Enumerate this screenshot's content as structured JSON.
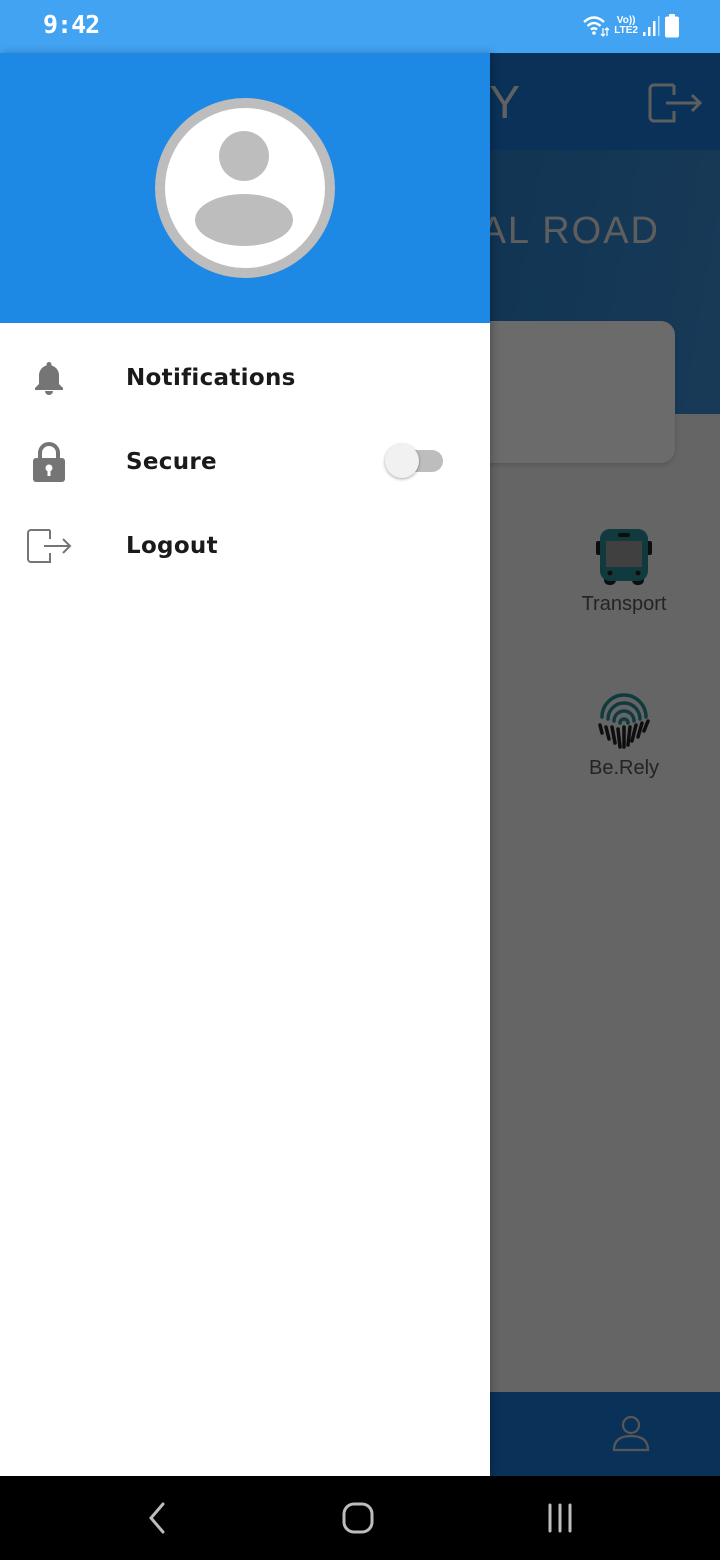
{
  "status_bar": {
    "time": "9:42",
    "network_label_top": "Vo))",
    "network_label_bottom": "LTE2",
    "icons": [
      "wifi-icon",
      "signal-icon",
      "battery-icon"
    ]
  },
  "background_app": {
    "title_fragment": "Y",
    "banner_text_fragment": "AL ROAD",
    "tiles": [
      {
        "label": "Transport",
        "icon": "bus-icon"
      },
      {
        "label": "Be.Rely",
        "icon": "fingerprint-icon"
      }
    ],
    "colors": {
      "header": "#1976d2",
      "bus": "#1f6b73"
    }
  },
  "drawer": {
    "avatar_icon": "default-user-avatar",
    "menu": [
      {
        "label": "Notifications",
        "icon": "bell-icon"
      },
      {
        "label": "Secure",
        "icon": "lock-icon",
        "toggle": {
          "on": false
        }
      },
      {
        "label": "Logout",
        "icon": "logout-icon"
      }
    ],
    "colors": {
      "header": "#1e88e5",
      "text": "#1a1a1a",
      "icon": "#757575"
    }
  },
  "nav_bar": {
    "buttons": [
      "back-icon",
      "home-icon",
      "recents-icon"
    ]
  }
}
